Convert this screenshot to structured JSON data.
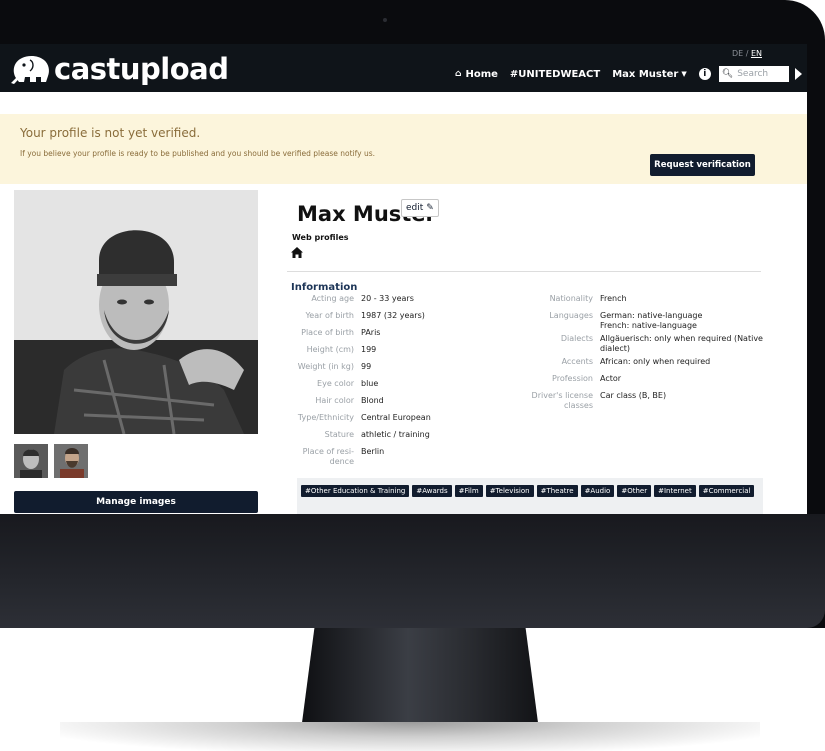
{
  "brand": {
    "name": "castupload"
  },
  "languages": {
    "de": "DE",
    "separator": "/",
    "en": "EN"
  },
  "nav": {
    "home": "Home",
    "unitedweact": "#UNITEDWEACT",
    "user": "Max Muster",
    "search_placeholder": "Search"
  },
  "alert": {
    "title": "Your profile is not yet verified.",
    "text": "If you believe your profile is ready to be published and you should be verified please notify us.",
    "button": "Request verification"
  },
  "profile": {
    "name": "Max Muster",
    "edit_label": "edit",
    "web_profiles": "Web profiles",
    "manage_images": "Manage images",
    "info_heading": "Information"
  },
  "info_left": [
    {
      "label": "Acting age",
      "value": "20 - 33 years"
    },
    {
      "label": "Year of birth",
      "value": "1987 (32 years)"
    },
    {
      "label": "Place of birth",
      "value": "PAris"
    },
    {
      "label": "Height (cm)",
      "value": "199"
    },
    {
      "label": "Weight (in kg)",
      "value": "99"
    },
    {
      "label": "Eye color",
      "value": "blue"
    },
    {
      "label": "Hair color",
      "value": "Blond"
    },
    {
      "label": "Type/Ethnicity",
      "value": "Central European"
    },
    {
      "label": "Stature",
      "value": "athletic / training"
    },
    {
      "label": "Place of resi-",
      "label2": "dence",
      "value": "Berlin"
    }
  ],
  "info_right": [
    {
      "label": "Nationality",
      "value": "French"
    },
    {
      "label": "Languages",
      "value": "German: native-language",
      "value2": "French: native-language"
    },
    {
      "label": "Dialects",
      "value": "Allgäuerisch: only when required (Native",
      "value2": "dialect)"
    },
    {
      "label": "Accents",
      "value": "African: only when required"
    },
    {
      "label": "Profession",
      "value": "Actor"
    },
    {
      "label": "Driver's license",
      "label2": "classes",
      "value": "Car class (B, BE)"
    }
  ],
  "tags": [
    "#Other Education & Training",
    "#Awards",
    "#Film",
    "#Television",
    "#Theatre",
    "#Audio",
    "#Other",
    "#Internet",
    "#Commercial"
  ],
  "colors": {
    "navbar": "#0f1419",
    "alert_bg": "#fcf5dc",
    "alert_text": "#8a6d3b",
    "button_dark": "#111c2e",
    "heading_blue": "#1d3557"
  },
  "icons": [
    "home-icon",
    "info-icon",
    "search-icon",
    "pencil-edit-icon",
    "caret-down-icon",
    "nav-arrow-icon"
  ]
}
